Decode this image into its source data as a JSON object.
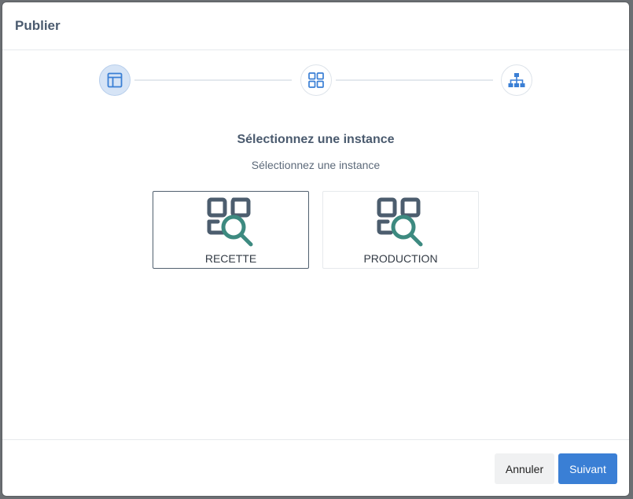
{
  "dialog": {
    "title": "Publier"
  },
  "stepper": {
    "steps": [
      {
        "icon": "layout-icon",
        "active": true
      },
      {
        "icon": "grid-icon",
        "active": false
      },
      {
        "icon": "sitemap-icon",
        "active": false
      }
    ]
  },
  "content": {
    "title": "Sélectionnez une instance",
    "subtitle": "Sélectionnez une instance",
    "instances": [
      {
        "label": "RECETTE",
        "icon": "scan-search-icon",
        "selected": true
      },
      {
        "label": "PRODUCTION",
        "icon": "scan-search-icon",
        "selected": false
      }
    ]
  },
  "footer": {
    "cancel_label": "Annuler",
    "next_label": "Suivant"
  },
  "colors": {
    "accent": "#3a7fd5",
    "icon_dark": "#4c5d6e",
    "icon_teal": "#3d8a80"
  }
}
